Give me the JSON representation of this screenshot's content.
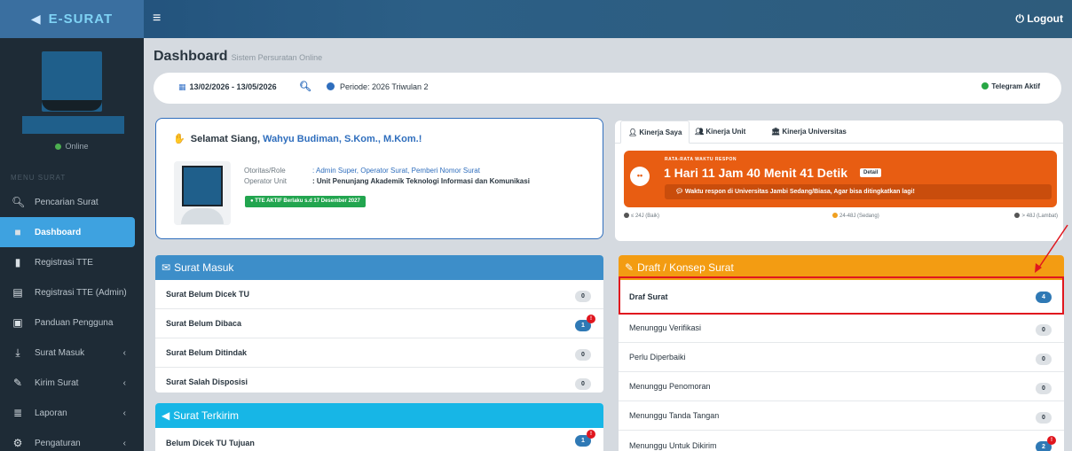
{
  "app": {
    "brand": "E-SURAT",
    "logout": "Logout"
  },
  "sidebar": {
    "status": "Online",
    "menu_header": "MENU SURAT",
    "items": [
      {
        "label": "Pencarian Surat",
        "icon": "search-icon"
      },
      {
        "label": "Dashboard",
        "icon": "file-icon"
      },
      {
        "label": "Registrasi TTE",
        "icon": "bookmark-icon"
      },
      {
        "label": "Registrasi TTE (Admin)",
        "icon": "id-card-icon"
      },
      {
        "label": "Panduan Pengguna",
        "icon": "book-icon"
      },
      {
        "label": "Surat Masuk",
        "icon": "download-icon"
      },
      {
        "label": "Kirim Surat",
        "icon": "edit-icon"
      },
      {
        "label": "Laporan",
        "icon": "database-icon"
      },
      {
        "label": "Pengaturan",
        "icon": "cogs-icon"
      }
    ]
  },
  "header": {
    "title": "Dashboard",
    "subtitle": "Sistem Persuratan Online"
  },
  "filter": {
    "date_range": "13/02/2026 - 13/05/2026",
    "periode": "Periode: 2026 Triwulan 2",
    "telegram": "Telegram Aktif"
  },
  "welcome": {
    "greeting": "Selamat Siang,",
    "user": "Wahyu Budiman, S.Kom., M.Kom.!",
    "role_label": "Otoritas/Role",
    "roles": ": Admin Super, Operator Surat, Pemberi Nomor Surat",
    "unit_label": "Operator Unit",
    "unit": ": Unit Penunjang Akademik Teknologi Informasi dan Komunikasi",
    "tte": "TTE AKTIF Berlaku s.d 17 Desember 2027"
  },
  "kinerja": {
    "tabs": [
      "Kinerja Saya",
      "Kinerja Unit",
      "Kinerja Universitas"
    ],
    "label": "RATA-RATA WAKTU RESPON",
    "value": "1 Hari 11 Jam 40 Menit 41 Detik",
    "detail": "Detail",
    "note": "Waktu respon di Universitas Jambi Sedang/Biasa, Agar bisa ditingkatkan lagi!",
    "legend": [
      "≤ 24J (Baik)",
      "24-48J (Sedang)",
      "> 48J (Lambat)"
    ],
    "colors": {
      "baik": "#555555",
      "sedang": "#f0a020",
      "lambat": "#555555"
    }
  },
  "surat_masuk": {
    "title": "Surat Masuk",
    "rows": [
      {
        "label": "Surat Belum Dicek TU",
        "count": "0"
      },
      {
        "label": "Surat Belum Dibaca",
        "count": "1",
        "alert": "!"
      },
      {
        "label": "Surat Belum Ditindak",
        "count": "0"
      },
      {
        "label": "Surat Salah Disposisi",
        "count": "0"
      }
    ]
  },
  "surat_terkirim": {
    "title": "Surat Terkirim",
    "rows": [
      {
        "label": "Belum Dicek TU Tujuan",
        "count": "1",
        "alert": "!"
      }
    ]
  },
  "draft": {
    "title": "Draft / Konsep Surat",
    "rows": [
      {
        "label": "Draf Surat",
        "count": "4"
      },
      {
        "label": "Menunggu Verifikasi",
        "count": "0"
      },
      {
        "label": "Perlu Diperbaiki",
        "count": "0"
      },
      {
        "label": "Menunggu Penomoran",
        "count": "0"
      },
      {
        "label": "Menunggu Tanda Tangan",
        "count": "0"
      },
      {
        "label": "Menunggu Untuk Dikirim",
        "count": "2",
        "alert": "!"
      }
    ]
  },
  "colors": {
    "accent": "#3ea2e0",
    "surat_masuk_head": "#3d8ec9",
    "surat_terkirim_head": "#17b6e6",
    "draft_head": "#f39c12",
    "highlight": "#e0161e"
  }
}
